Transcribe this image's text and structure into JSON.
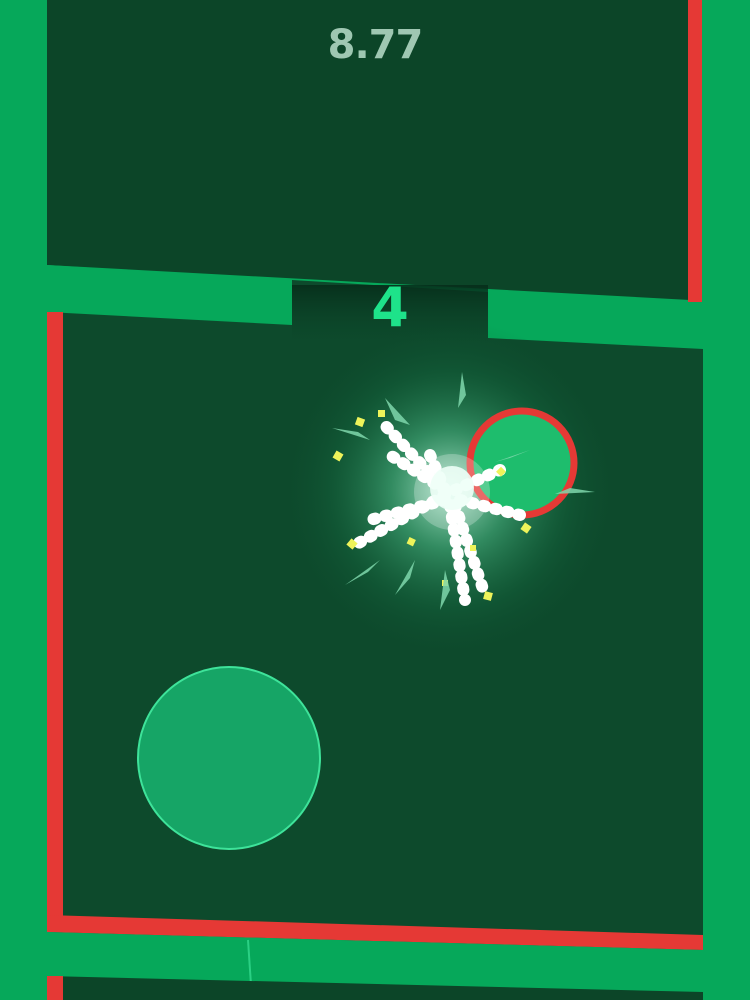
{
  "hud": {
    "timer": "8.77",
    "gate_number": "4"
  },
  "colors": {
    "background_dark": "#0c4528",
    "floor": "#0d4a2c",
    "wall_green": "#06a85a",
    "wall_hazard_red": "#e53935",
    "player_ball": "#1ebd6d",
    "joystick": "#16a566",
    "burst_white": "#ffffff",
    "burst_yellow": "#eef35a"
  },
  "icons": {
    "player": "green-ball-red-ring-icon",
    "joystick": "virtual-joystick-icon",
    "burst": "particle-explosion-icon"
  }
}
